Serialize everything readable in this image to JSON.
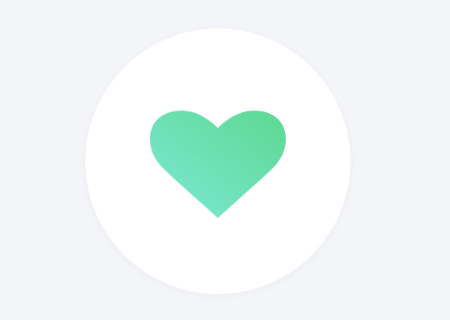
{
  "theme": {
    "background": "#f4f5f8",
    "card": "#ffffff"
  },
  "icon": {
    "name": "heart-icon",
    "gradient_start": "#7ee8d8",
    "gradient_end": "#5dd890"
  }
}
